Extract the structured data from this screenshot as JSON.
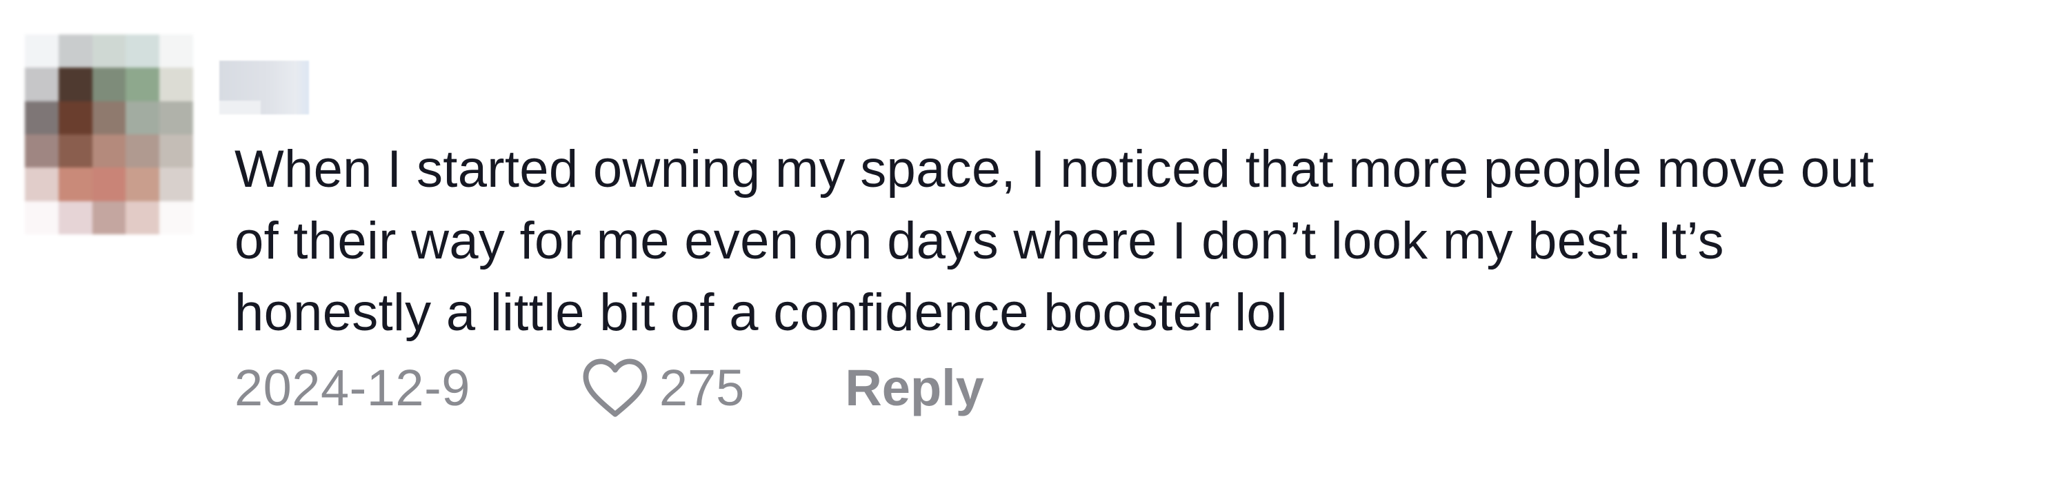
{
  "comment": {
    "author": "",
    "text_lines": [
      "When I started owning my space, I noticed that more people move out",
      "of their way for me even on days where I don’t look my best. It’s",
      "honestly a little bit of a confidence booster lol"
    ],
    "date": "2024-12-9",
    "likes": "275",
    "reply_label": "Reply",
    "like_icon": "heart-outline-icon"
  },
  "avatar": {
    "pixels": [
      "#f2f4f6",
      "#c9cccd",
      "#cfd8d3",
      "#d3dfdd",
      "#f4f5f5",
      "#c6c6c8",
      "#4f3a30",
      "#7e8c7a",
      "#8ea88d",
      "#dcdcd4",
      "#7e7676",
      "#6a3e2e",
      "#8f7a6e",
      "#a2aca1",
      "#b0b2aa",
      "#9f8682",
      "#8a5e4e",
      "#b48a7c",
      "#b09a90",
      "#c4bdb6",
      "#e1cdca",
      "#c98a79",
      "#c98477",
      "#c99e8d",
      "#d8d0cc",
      "#fbf7f8",
      "#e6d4d6",
      "#c4a6a0",
      "#e2cbc6",
      "#fbf9f9"
    ]
  },
  "colors": {
    "text": "#161823",
    "meta": "#8a8b91",
    "background": "#ffffff"
  }
}
